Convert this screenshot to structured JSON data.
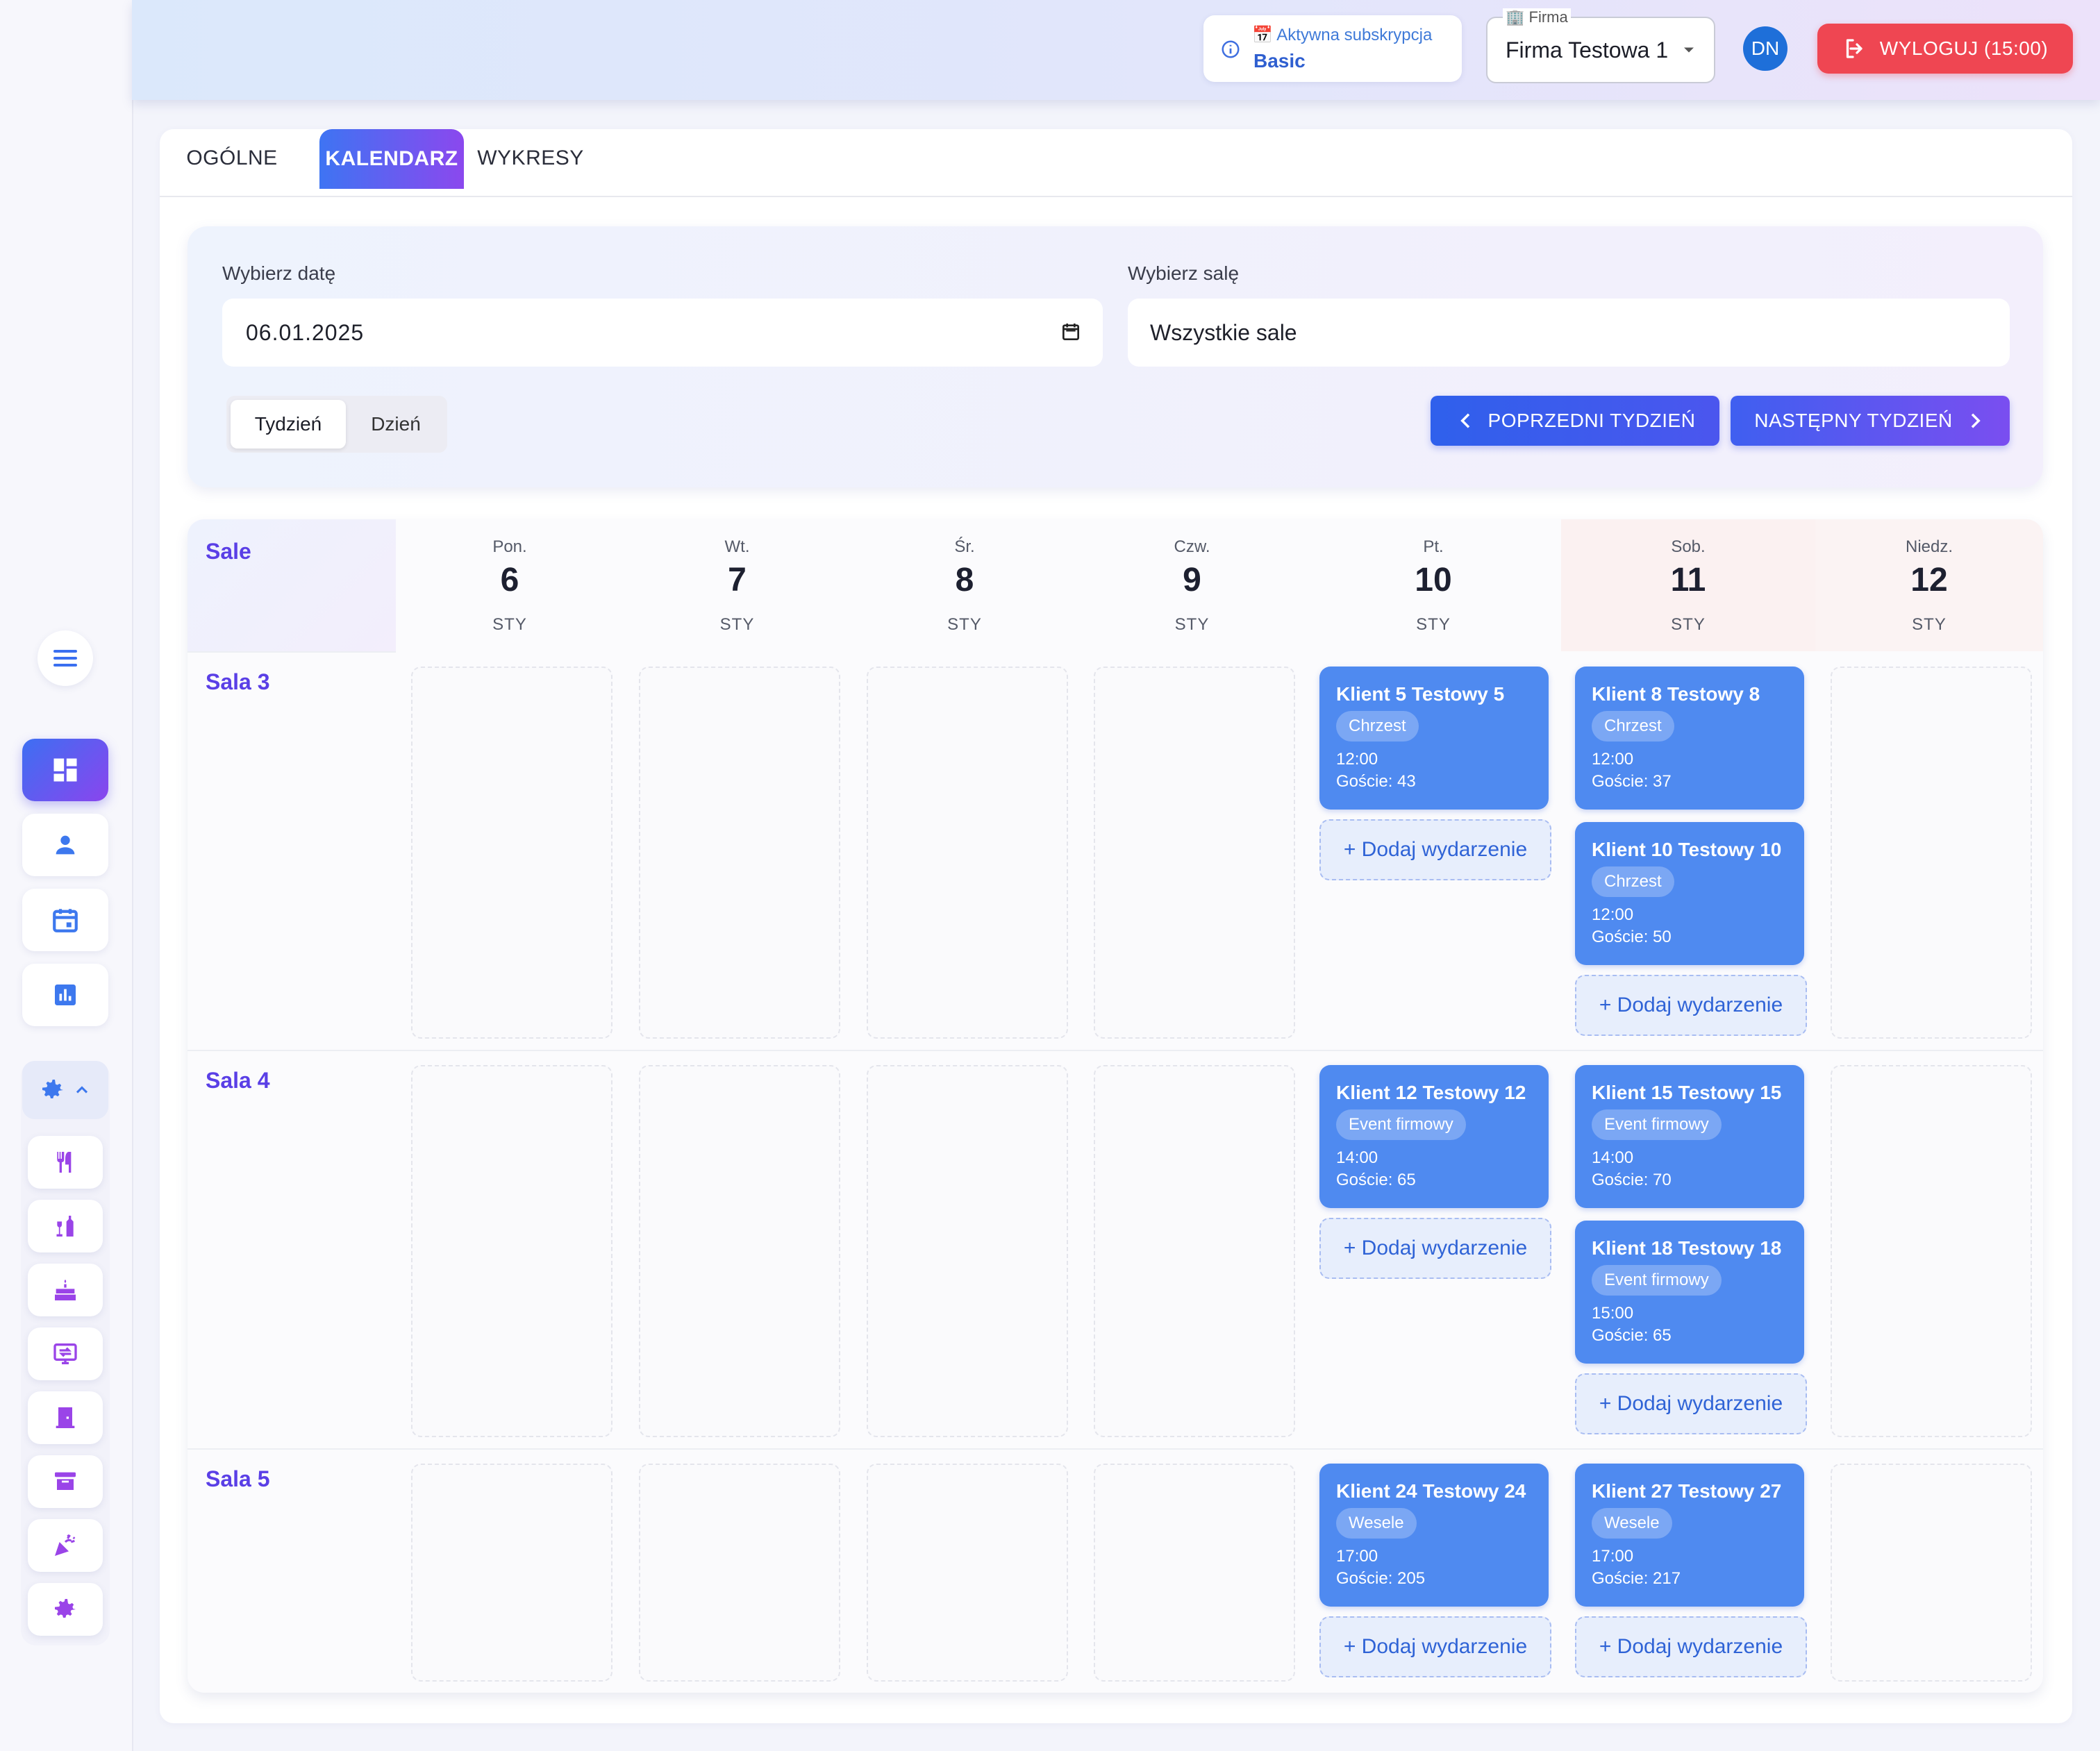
{
  "topbar": {
    "subscription_label": "📅 Aktywna subskrypcja",
    "subscription_plan": "Basic",
    "firm_label": "🏢 Firma",
    "firm_value": "Firma Testowa 1",
    "avatar_initials": "DN",
    "logout_label": "WYLOGUJ (15:00)"
  },
  "tabs": [
    {
      "label": "OGÓLNE"
    },
    {
      "label": "KALENDARZ"
    },
    {
      "label": "WYKRESY"
    }
  ],
  "filters": {
    "date_label": "Wybierz datę",
    "date_value": "06.01.2025",
    "room_label": "Wybierz salę",
    "room_value": "Wszystkie sale",
    "view_week": "Tydzień",
    "view_day": "Dzień",
    "prev_week": "POPRZEDNI TYDZIEŃ",
    "next_week": "NASTĘPNY TYDZIEŃ"
  },
  "calendar": {
    "rooms_header": "Sale",
    "days": [
      {
        "name": "Pon.",
        "num": "6",
        "month": "STY"
      },
      {
        "name": "Wt.",
        "num": "7",
        "month": "STY"
      },
      {
        "name": "Śr.",
        "num": "8",
        "month": "STY"
      },
      {
        "name": "Czw.",
        "num": "9",
        "month": "STY"
      },
      {
        "name": "Pt.",
        "num": "10",
        "month": "STY"
      },
      {
        "name": "Sob.",
        "num": "11",
        "month": "STY"
      },
      {
        "name": "Niedz.",
        "num": "12",
        "month": "STY"
      }
    ],
    "rooms": [
      {
        "name": "Sala 3"
      },
      {
        "name": "Sala 4"
      },
      {
        "name": "Sala 5"
      }
    ],
    "add_label": "+ Dodaj wydarzenie",
    "events": {
      "e1": {
        "title": "Klient 5 Testowy 5",
        "type": "Chrzest",
        "time": "12:00",
        "guests": "Goście: 43"
      },
      "e2": {
        "title": "Klient 8 Testowy 8",
        "type": "Chrzest",
        "time": "12:00",
        "guests": "Goście: 37"
      },
      "e3": {
        "title": "Klient 10 Testowy 10",
        "type": "Chrzest",
        "time": "12:00",
        "guests": "Goście: 50"
      },
      "e4": {
        "title": "Klient 12 Testowy 12",
        "type": "Event firmowy",
        "time": "14:00",
        "guests": "Goście: 65"
      },
      "e5": {
        "title": "Klient 15 Testowy 15",
        "type": "Event firmowy",
        "time": "14:00",
        "guests": "Goście: 70"
      },
      "e6": {
        "title": "Klient 18 Testowy 18",
        "type": "Event firmowy",
        "time": "15:00",
        "guests": "Goście: 65"
      },
      "e7": {
        "title": "Klient 24 Testowy 24",
        "type": "Wesele",
        "time": "17:00",
        "guests": "Goście: 205"
      },
      "e8": {
        "title": "Klient 27 Testowy 27",
        "type": "Wesele",
        "time": "17:00",
        "guests": "Goście: 217"
      }
    }
  },
  "sidebar": {
    "icons": [
      "menu-icon",
      "dashboard-icon",
      "user-icon",
      "calendar-icon",
      "chart-icon",
      "settings-icon",
      "cutlery-icon",
      "bottles-icon",
      "cake-icon",
      "presentation-icon",
      "door-icon",
      "archive-icon",
      "party-popper-icon",
      "gear-icon"
    ]
  },
  "colors": {
    "accent_blue": "#4f8af0",
    "accent_purple": "#8a45ee",
    "logout_red": "#ef4652",
    "room_label": "#5a3fe6"
  }
}
